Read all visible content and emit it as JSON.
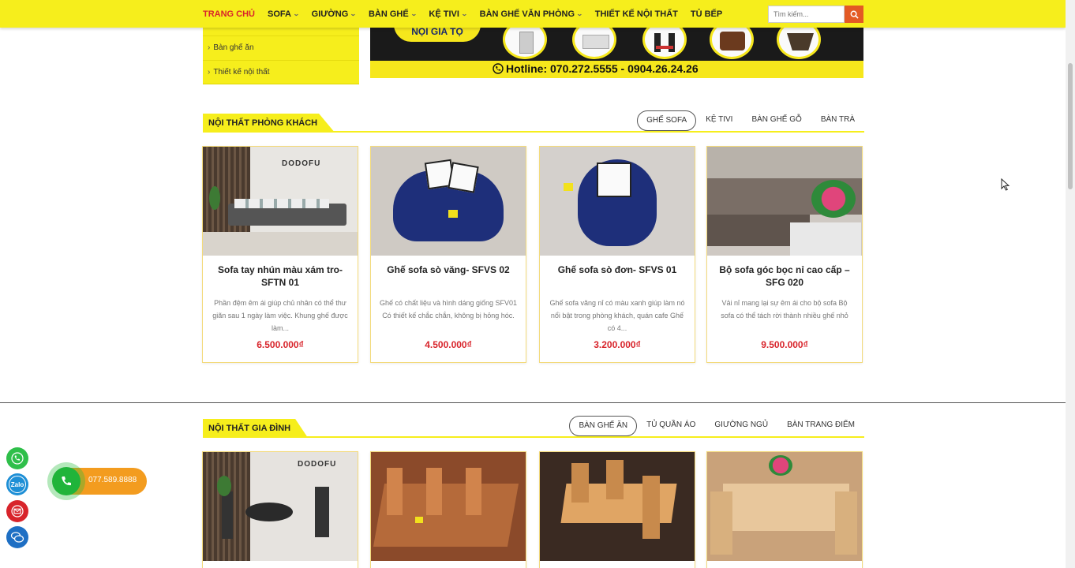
{
  "nav": {
    "items": [
      {
        "label": "TRANG CHỦ",
        "dropdown": false,
        "active": true
      },
      {
        "label": "SOFA",
        "dropdown": true
      },
      {
        "label": "GIƯỜNG",
        "dropdown": true
      },
      {
        "label": "BÀN GHẾ",
        "dropdown": true
      },
      {
        "label": "KỆ TIVI",
        "dropdown": true
      },
      {
        "label": "BÀN GHẾ VĂN PHÒNG",
        "dropdown": true
      },
      {
        "label": "THIẾT KẾ NỘI THẤT",
        "dropdown": false
      },
      {
        "label": "TỦ BẾP",
        "dropdown": false
      }
    ],
    "search_placeholder": "Tìm kiếm..."
  },
  "sidebar": {
    "items": [
      "Bàn ghế ăn",
      "Thiết kế nội thất"
    ]
  },
  "banner": {
    "slogan": "NỘI GIA TỘ",
    "hotline": "Hotline: 070.272.5555 - 0904.26.24.26"
  },
  "section_living": {
    "title": "NỘI THẤT PHÒNG KHÁCH",
    "tabs": [
      "GHẾ SOFA",
      "KỆ TIVI",
      "BÀN GHẾ GỖ",
      "BÀN TRÀ"
    ],
    "active_tab": 0,
    "products": [
      {
        "name": "Sofa tay nhún màu xám tro- SFTN 01",
        "desc": "Phần đệm êm ái giúp chủ nhân có thể thư giãn sau 1 ngày làm việc. Khung ghế được làm...",
        "price": "6.500.000₫",
        "image_logo": "DODOFU"
      },
      {
        "name": "Ghế sofa sò văng- SFVS 02",
        "desc": "Ghế có chất liệu và hình dáng giống SFV01 Có thiết kế chắc chắn, không bị hỏng hóc.",
        "price": "4.500.000₫"
      },
      {
        "name": "Ghế sofa sò đơn- SFVS 01",
        "desc": "Ghế sofa văng nỉ có màu xanh giúp làm nó nổi bật trong phòng khách, quán cafe Ghế có 4...",
        "price": "3.200.000₫"
      },
      {
        "name": "Bộ sofa góc bọc nỉ cao cấp – SFG 020",
        "desc": "Vải nỉ mang lại sự êm ái cho bộ sofa Bộ sofa có thể tách rời thành nhiều ghế nhỏ",
        "price": "9.500.000₫"
      }
    ]
  },
  "section_family": {
    "title": "NỘI THẤT GIA ĐÌNH",
    "tabs": [
      "BÀN GHẾ ĂN",
      "TỦ QUẦN ÁO",
      "GIƯỜNG NGỦ",
      "BÀN TRANG ĐIỂM"
    ],
    "active_tab": 0,
    "products": [
      {
        "image_logo": "DODOFU"
      },
      {},
      {},
      {}
    ]
  },
  "contact": {
    "phone": "077.589.8888",
    "buttons": [
      "phone-icon",
      "zalo-icon",
      "mail-icon",
      "chat-icon"
    ],
    "zalo_label": "Zalo"
  },
  "colors": {
    "brand_yellow": "#f6ee1c",
    "price_red": "#d8242b",
    "search_orange": "#e35a24",
    "phone_green": "#20b43a"
  }
}
